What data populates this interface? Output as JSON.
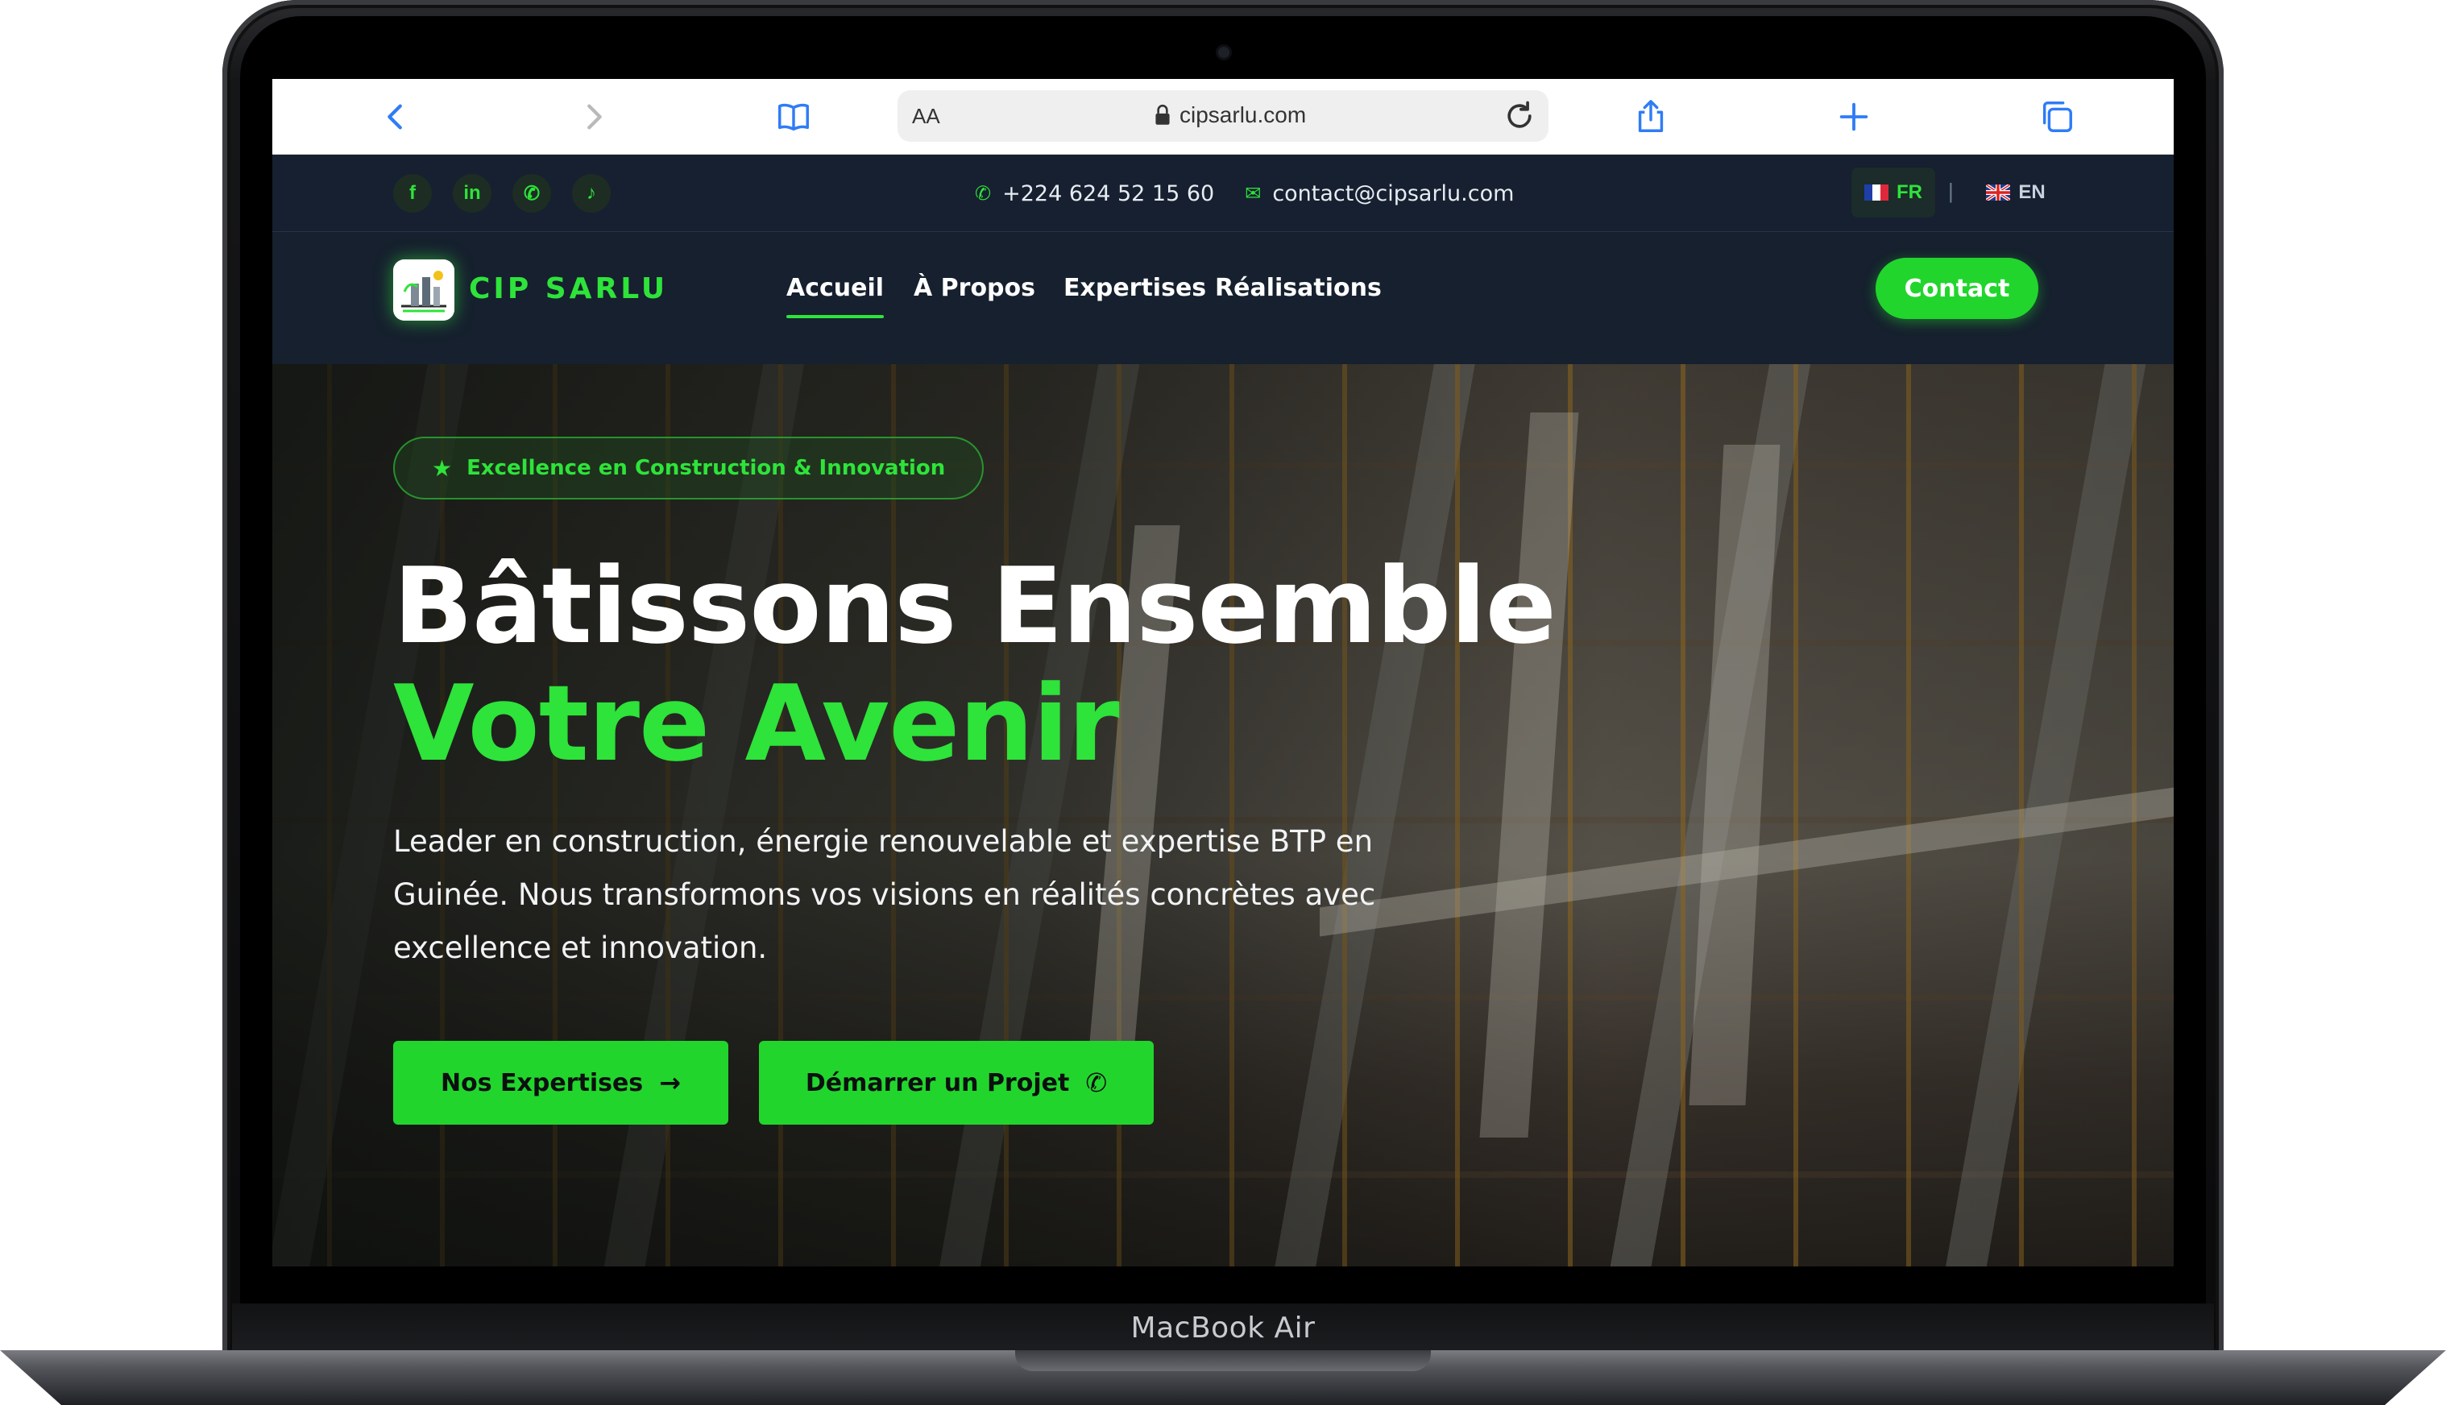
{
  "device": {
    "label": "MacBook Air"
  },
  "browser": {
    "address_prefix": "AA",
    "url": "cipsarlu.com",
    "icons": [
      "back-icon",
      "forward-icon",
      "bookmarks-icon",
      "lock-icon",
      "reload-icon",
      "share-icon",
      "new-tab-icon",
      "tabs-icon"
    ]
  },
  "topbar": {
    "social": [
      {
        "name": "facebook-icon",
        "glyph": "f"
      },
      {
        "name": "linkedin-icon",
        "glyph": "in"
      },
      {
        "name": "whatsapp-icon",
        "glyph": "✆"
      },
      {
        "name": "tiktok-icon",
        "glyph": "♪"
      }
    ],
    "phone": "+224 624 52 15 60",
    "email": "contact@cipsarlu.com",
    "lang_fr": "FR",
    "lang_sep": "|",
    "lang_en": "EN"
  },
  "nav": {
    "brand": "CIP SARLU",
    "links": [
      "Accueil",
      "À Propos",
      "Expertises",
      "Réalisations"
    ],
    "active": "Accueil",
    "cta": "Contact"
  },
  "hero": {
    "badge": "Excellence en Construction & Innovation",
    "title_line1": "Bâtissons Ensemble",
    "title_line2": "Votre Avenir",
    "lead": "Leader en construction, énergie renouvelable et expertise BTP en Guinée. Nous transformons vos visions en réalités concrètes avec excellence et innovation.",
    "btn_primary": "Nos Expertises",
    "btn_secondary": "Démarrer un Projet"
  },
  "colors": {
    "accent": "#2ee33a",
    "button": "#22d52d",
    "nav_bg": "#16202e",
    "topbar_bg": "#162030"
  }
}
